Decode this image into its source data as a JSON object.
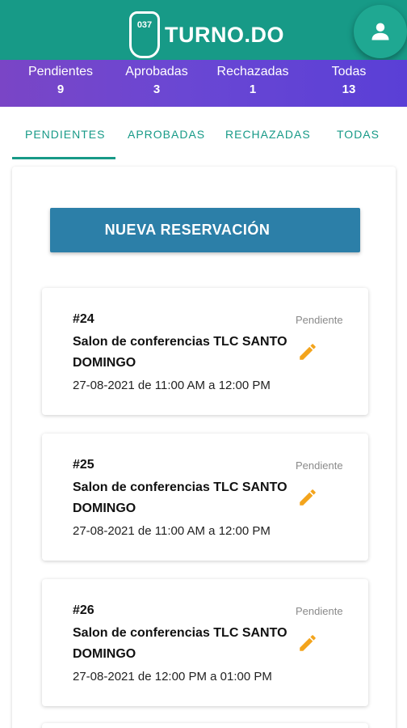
{
  "app": {
    "logo_text": "TURNO.DO",
    "logo_badge": "037",
    "profile_icon": "person-icon"
  },
  "stats": [
    {
      "label": "Pendientes",
      "count": "9"
    },
    {
      "label": "Aprobadas",
      "count": "3"
    },
    {
      "label": "Rechazadas",
      "count": "1"
    },
    {
      "label": "Todas",
      "count": "13"
    }
  ],
  "tabs": [
    {
      "label": "PENDIENTES",
      "active": true
    },
    {
      "label": "APROBADAS",
      "active": false
    },
    {
      "label": "RECHAZADAS",
      "active": false
    },
    {
      "label": "TODAS",
      "active": false
    }
  ],
  "new_reservation": {
    "label": "NUEVA RESERVACIÓN",
    "icon": "add-check-icon"
  },
  "reservations": [
    {
      "number": "#24",
      "title": "Salon de conferencias TLC SANTO DOMINGO",
      "date": "27-08-2021 de 11:00 AM a 12:00 PM",
      "status": "Pendiente",
      "edit_icon": "pencil-icon"
    },
    {
      "number": "#25",
      "title": "Salon de conferencias TLC SANTO DOMINGO",
      "date": "27-08-2021 de 11:00 AM a 12:00 PM",
      "status": "Pendiente",
      "edit_icon": "pencil-icon"
    },
    {
      "number": "#26",
      "title": "Salon de conferencias TLC SANTO DOMINGO",
      "date": "27-08-2021 de 12:00 PM a 01:00 PM",
      "status": "Pendiente",
      "edit_icon": "pencil-icon"
    }
  ],
  "colors": {
    "header": "#179a87",
    "accent": "#179a87",
    "button": "#2c7fa8",
    "edit_icon": "#f3a41c",
    "status_text": "#8a8a8a"
  }
}
